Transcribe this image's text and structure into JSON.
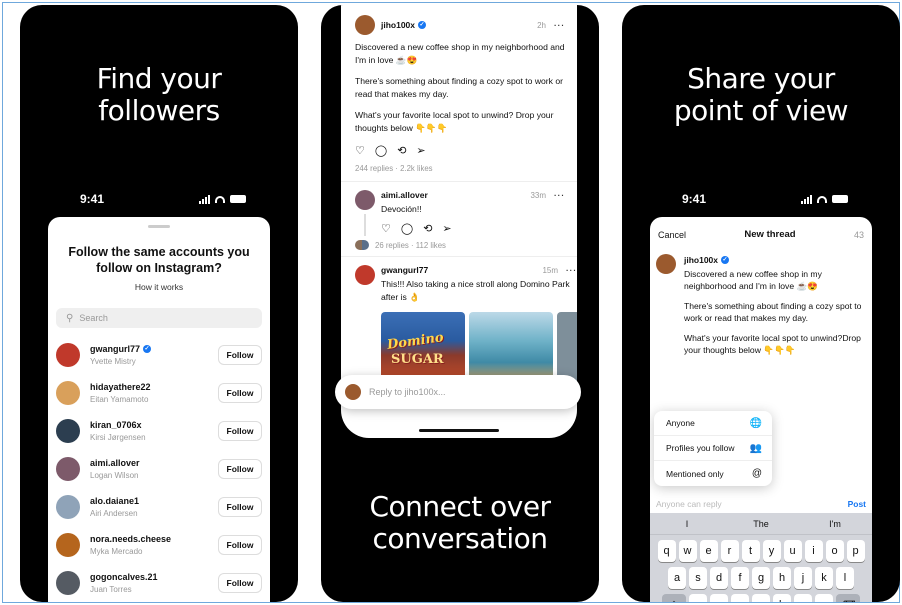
{
  "panels": [
    {
      "promo_line1": "Find your",
      "promo_line2": "followers"
    },
    {
      "promo_line1": "Connect over",
      "promo_line2": "conversation"
    },
    {
      "promo_line1": "Share your",
      "promo_line2": "point of view"
    }
  ],
  "status": {
    "time": "9:41"
  },
  "follow_sheet": {
    "title": "Follow the same accounts you follow on Instagram?",
    "subtitle": "How it works",
    "search_placeholder": "Search",
    "follow_label": "Follow",
    "accounts": [
      {
        "username": "gwangurl77",
        "name": "Yvette Mistry",
        "verified": true,
        "color": "#c0392b"
      },
      {
        "username": "hidayathere22",
        "name": "Eitan Yamamoto",
        "verified": false,
        "color": "#d9a05b"
      },
      {
        "username": "kiran_0706x",
        "name": "Kirsi Jørgensen",
        "verified": false,
        "color": "#2c3e50"
      },
      {
        "username": "aimi.allover",
        "name": "Logan Wilson",
        "verified": false,
        "color": "#7d5a6a"
      },
      {
        "username": "alo.daiane1",
        "name": "Airi Andersen",
        "verified": false,
        "color": "#8fa3b8"
      },
      {
        "username": "nora.needs.cheese",
        "name": "Myka Mercado",
        "verified": false,
        "color": "#b5651d"
      },
      {
        "username": "gogoncalves.21",
        "name": "Juan Torres",
        "verified": false,
        "color": "#555b63"
      }
    ]
  },
  "feed": {
    "post": {
      "username": "jiho100x",
      "time": "2h",
      "paragraphs": [
        "Discovered a new coffee shop in my neighborhood and I'm in love ☕😍",
        "There's something about finding a cozy spot to work or read that makes my day.",
        "What's your favorite local spot to unwind? Drop your thoughts below 👇👇👇"
      ],
      "stats": "244 replies · 2.2k likes"
    },
    "reply1": {
      "username": "aimi.allover",
      "time": "33m",
      "text": "Devoción!!",
      "stats": "26 replies · 112 likes"
    },
    "reply2": {
      "username": "gwangurl77",
      "time": "15m",
      "text": "This!!! Also taking a nice stroll along Domino Park after is 👌",
      "image_text1": "Domino",
      "image_text2": "SUGAR"
    },
    "reply_placeholder": "Reply to jiho100x..."
  },
  "new_thread": {
    "cancel": "Cancel",
    "title": "New thread",
    "count": "43",
    "username": "jiho100x",
    "paragraphs": [
      "Discovered a new coffee shop in my neighborhood and I'm in love ☕😍",
      "There's something about finding a cozy spot to work or read that makes my day.",
      "What's your favorite local spot to unwind?Drop your thoughts below 👇👇👇"
    ],
    "menu": [
      {
        "label": "Anyone",
        "icon": "globe-icon",
        "glyph": "🌐"
      },
      {
        "label": "Profiles you follow",
        "icon": "people-icon",
        "glyph": "👥"
      },
      {
        "label": "Mentioned only",
        "icon": "at-icon",
        "glyph": "@"
      }
    ],
    "reply_hint": "Anyone can reply",
    "post_label": "Post",
    "suggestions": [
      "I",
      "The",
      "I'm"
    ],
    "rows": [
      [
        "q",
        "w",
        "e",
        "r",
        "t",
        "y",
        "u",
        "i",
        "o",
        "p"
      ],
      [
        "a",
        "s",
        "d",
        "f",
        "g",
        "h",
        "j",
        "k",
        "l"
      ],
      [
        "⇧",
        "z",
        "x",
        "c",
        "v",
        "b",
        "n",
        "m",
        "⌫"
      ]
    ]
  }
}
